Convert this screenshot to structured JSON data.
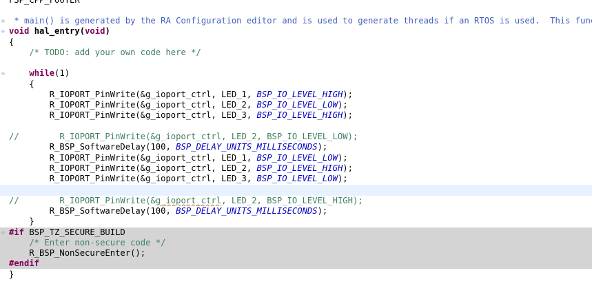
{
  "editor": {
    "lines": {
      "l0": "FSP_CPP_FOOTER",
      "l1_doc": " * main() is generated by the RA Configuration editor and is used to generate threads if an RTOS is used.  This func",
      "l2_kw": "void",
      "l2_name": " hal_entry(",
      "l2_kw2": "void",
      "l2_end": ")",
      "l3": "{",
      "l4": "    /* TODO: add your own code here */",
      "l5_indent": "    ",
      "l5_kw": "while",
      "l5_rest": "(1)",
      "l6": "    {",
      "w1_pre": "        R_IOPORT_PinWrite(&g_ioport_ctrl, LED_1, ",
      "w1_macro": "BSP_IO_LEVEL_HIGH",
      "w1_end": ");",
      "w2_pre": "        R_IOPORT_PinWrite(&g_ioport_ctrl, LED_2, ",
      "w2_macro": "BSP_IO_LEVEL_LOW",
      "w2_end": ");",
      "w3_pre": "        R_IOPORT_PinWrite(&g_ioport_ctrl, LED_3, ",
      "w3_macro": "BSP_IO_LEVEL_HIGH",
      "w3_end": ");",
      "c1": "//        R_IOPORT_PinWrite(&g_ioport_ctrl, LED_2, BSP_IO_LEVEL_LOW);",
      "d1_pre": "        R_BSP_SoftwareDelay(100, ",
      "d1_macro": "BSP_DELAY_UNITS_MILLISECONDS",
      "d1_end": ");",
      "w4_pre": "        R_IOPORT_PinWrite(&g_ioport_ctrl, LED_1, ",
      "w4_macro": "BSP_IO_LEVEL_LOW",
      "w4_end": ");",
      "w5_pre": "        R_IOPORT_PinWrite(&g_ioport_ctrl, LED_2, ",
      "w5_macro": "BSP_IO_LEVEL_HIGH",
      "w5_end": ");",
      "w6_pre": "        R_IOPORT_PinWrite(&g_ioport_ctrl, LED_3, ",
      "w6_macro": "BSP_IO_LEVEL_LOW",
      "w6_end": ");",
      "c2_a": "//        R_IOPORT_PinWrite(&",
      "c2_b": "g_ioport_ctrl",
      "c2_c": ", LED_2, BSP_IO_LEVEL_HIGH);",
      "d2_pre": "        R_BSP_SoftwareDelay(100, ",
      "d2_macro": "BSP_DELAY_UNITS_MILLISECONDS",
      "d2_end": ");",
      "close1": "    }",
      "if_kw": "#if",
      "if_rest": " BSP_TZ_SECURE_BUILD",
      "if_comment": "    /* Enter non-secure code */",
      "if_call": "    R_BSP_NonSecureEnter();",
      "endif_kw": "#endif",
      "close2": "}"
    }
  }
}
